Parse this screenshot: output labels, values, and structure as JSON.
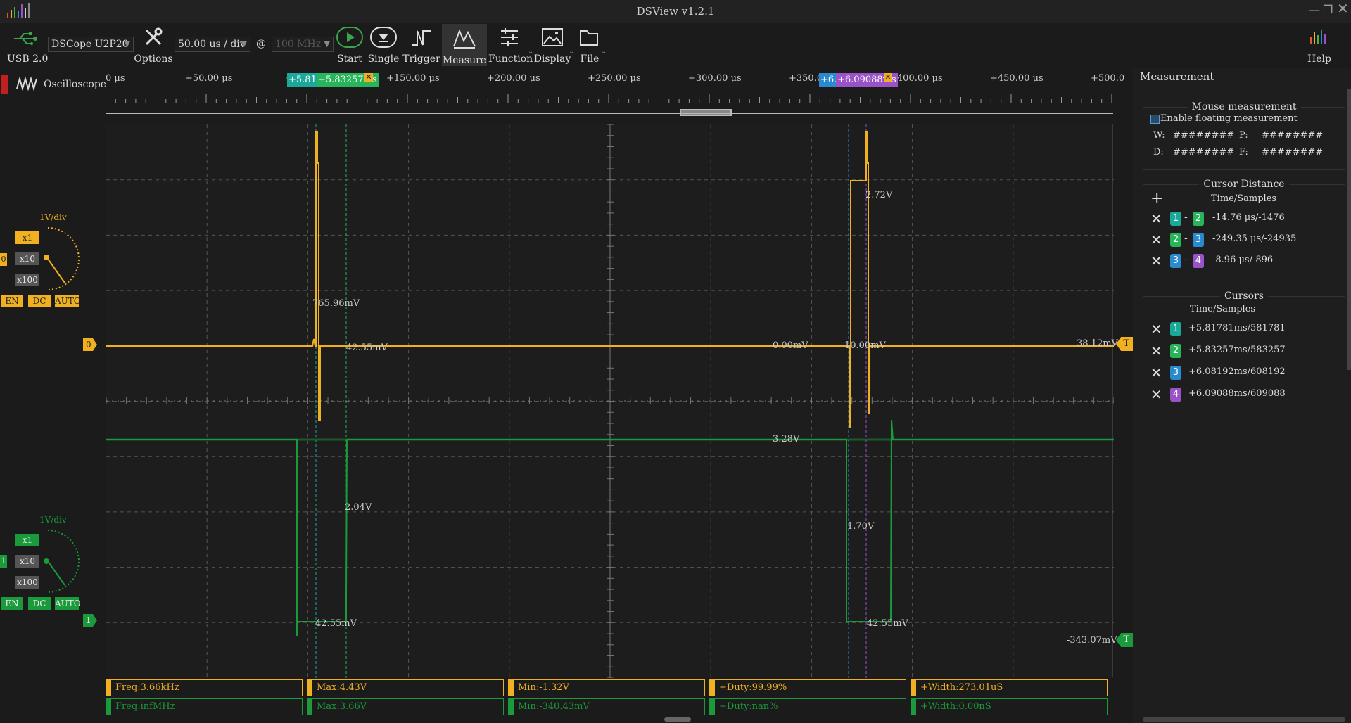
{
  "app": {
    "title": "DSView v1.2.1"
  },
  "toolbar": {
    "usb_label": "USB 2.0",
    "device": "DSCope U2P20",
    "options_label": "Options",
    "timebase": "50.00 us / div",
    "at": "@",
    "samplerate": "100 MHz",
    "start": "Start",
    "single": "Single",
    "trigger": "Trigger",
    "measure": "Measure",
    "function": "Function",
    "display": "Display",
    "file": "File",
    "help": "Help"
  },
  "mode": {
    "label": "Oscilloscope"
  },
  "ruler": {
    "ticks": [
      "0 μs",
      "+50.00 μs",
      "+100.00 μs",
      "+150.00 μs",
      "+200.00 μs",
      "+250.00 μs",
      "+300.00 μs",
      "+350.00 μs",
      "+400.00 μs",
      "+450.00 μs",
      "+500.0"
    ],
    "flags": {
      "c1": "+5.817",
      "c2": "+5.83257ms",
      "c3": "+6.0",
      "c4": "+6.09088ms"
    }
  },
  "channels": [
    {
      "index": "0",
      "color": "#f0b020",
      "vdiv": "1V/div",
      "x1": "x1",
      "x10": "x10",
      "x100": "x100",
      "en": "EN",
      "dc": "DC",
      "auto": "AUTO",
      "offset_label": "0"
    },
    {
      "index": "1",
      "color": "#1a9a3a",
      "vdiv": "1V/div",
      "x1": "x1",
      "x10": "x10",
      "x100": "x100",
      "en": "EN",
      "dc": "DC",
      "auto": "AUTO",
      "offset_label": "1"
    }
  ],
  "trigger": {
    "t_label": "T"
  },
  "measure_labels": {
    "m1": "765.96mV",
    "m2": "42.55mV",
    "m3": "2.72V",
    "m4": "0.00mV",
    "m5": "10.00mV",
    "m6": "38.12mV",
    "m7": "3.28V",
    "m8": "2.04V",
    "m9": "1.70V",
    "m10": "42.55mV",
    "m11": "42.55mV",
    "m12": "-343.07mV"
  },
  "measure_bar": {
    "ch0": [
      "Freq:3.66kHz",
      "Max:4.43V",
      "Min:-1.32V",
      "+Duty:99.99%",
      "+Width:273.01uS"
    ],
    "ch1": [
      "Freq:infMHz",
      "Max:3.66V",
      "Min:-340.43mV",
      "+Duty:nan%",
      "+Width:0.00nS"
    ]
  },
  "panel": {
    "title": "Measurement",
    "mouse": {
      "title": "Mouse measurement",
      "enable": "Enable floating measurement",
      "w": "W:",
      "p": "P:",
      "d": "D:",
      "f": "F:",
      "val": "########"
    },
    "distance": {
      "title": "Cursor Distance",
      "header": "Time/Samples",
      "rows": [
        {
          "a": "1",
          "b": "2",
          "value": "-14.76 μs/-1476"
        },
        {
          "a": "2",
          "b": "3",
          "value": "-249.35 μs/-24935"
        },
        {
          "a": "3",
          "b": "4",
          "value": "-8.96 μs/-896"
        }
      ]
    },
    "cursors": {
      "title": "Cursors",
      "header": "Time/Samples",
      "rows": [
        {
          "n": "1",
          "value": "+5.81781ms/581781"
        },
        {
          "n": "2",
          "value": "+5.83257ms/583257"
        },
        {
          "n": "3",
          "value": "+6.08192ms/608192"
        },
        {
          "n": "4",
          "value": "+6.09088ms/609088"
        }
      ]
    }
  },
  "colors": {
    "cursor1": "#1aa89a",
    "cursor2": "#27b45a",
    "cursor3": "#2a8ad0",
    "cursor4": "#9a52c8",
    "ch0": "#f0b020",
    "ch1": "#1a9a3a"
  }
}
